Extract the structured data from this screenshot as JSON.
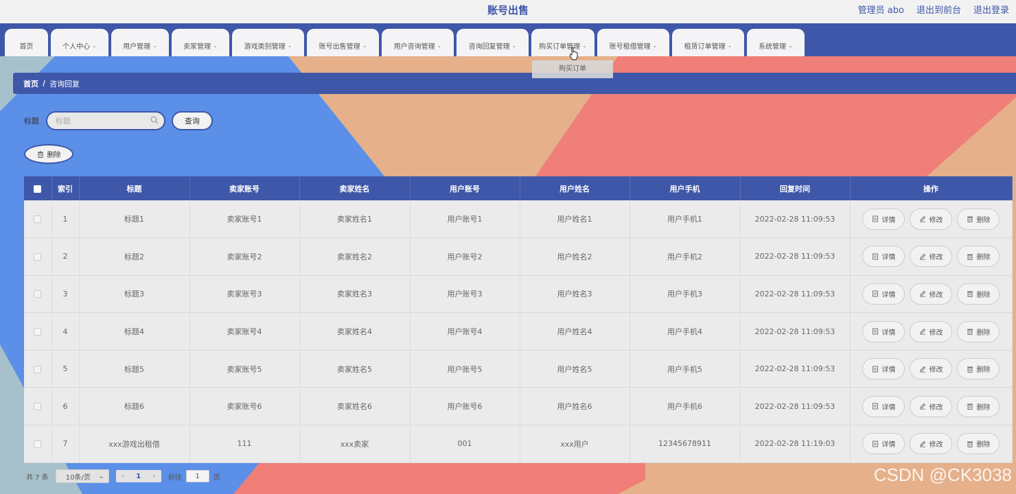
{
  "app": {
    "title": "账号出售"
  },
  "header": {
    "links": [
      "管理员 abo",
      "退出到前台",
      "退出登录"
    ]
  },
  "nav": {
    "tabs": [
      {
        "label": "首页",
        "has_dropdown": false
      },
      {
        "label": "个人中心",
        "has_dropdown": true
      },
      {
        "label": "用户管理",
        "has_dropdown": true
      },
      {
        "label": "卖家管理",
        "has_dropdown": true
      },
      {
        "label": "游戏类别管理",
        "has_dropdown": true
      },
      {
        "label": "账号出售管理",
        "has_dropdown": true
      },
      {
        "label": "用户咨询管理",
        "has_dropdown": true
      },
      {
        "label": "咨询回复管理",
        "has_dropdown": true
      },
      {
        "label": "购买订单管理",
        "has_dropdown": true
      },
      {
        "label": "账号租借管理",
        "has_dropdown": true
      },
      {
        "label": "租赁订单管理",
        "has_dropdown": true
      },
      {
        "label": "系统管理",
        "has_dropdown": true
      }
    ],
    "open_dropdown": {
      "item": "购买订单"
    }
  },
  "breadcrumb": {
    "home": "首页",
    "separator": "/",
    "current": "咨询回复"
  },
  "search": {
    "label": "标题",
    "placeholder": "标题",
    "value": "",
    "button": "查询"
  },
  "toolbar": {
    "delete_label": "删除"
  },
  "table": {
    "columns": [
      "索引",
      "标题",
      "卖家账号",
      "卖家姓名",
      "用户账号",
      "用户姓名",
      "用户手机",
      "回复时间",
      "操作"
    ],
    "rows": [
      {
        "index": "1",
        "title": "标题1",
        "seller_account": "卖家账号1",
        "seller_name": "卖家姓名1",
        "user_account": "用户账号1",
        "user_name": "用户姓名1",
        "user_phone": "用户手机1",
        "reply_time": "2022-02-28 11:09:53"
      },
      {
        "index": "2",
        "title": "标题2",
        "seller_account": "卖家账号2",
        "seller_name": "卖家姓名2",
        "user_account": "用户账号2",
        "user_name": "用户姓名2",
        "user_phone": "用户手机2",
        "reply_time": "2022-02-28 11:09:53"
      },
      {
        "index": "3",
        "title": "标题3",
        "seller_account": "卖家账号3",
        "seller_name": "卖家姓名3",
        "user_account": "用户账号3",
        "user_name": "用户姓名3",
        "user_phone": "用户手机3",
        "reply_time": "2022-02-28 11:09:53"
      },
      {
        "index": "4",
        "title": "标题4",
        "seller_account": "卖家账号4",
        "seller_name": "卖家姓名4",
        "user_account": "用户账号4",
        "user_name": "用户姓名4",
        "user_phone": "用户手机4",
        "reply_time": "2022-02-28 11:09:53"
      },
      {
        "index": "5",
        "title": "标题5",
        "seller_account": "卖家账号5",
        "seller_name": "卖家姓名5",
        "user_account": "用户账号5",
        "user_name": "用户姓名5",
        "user_phone": "用户手机5",
        "reply_time": "2022-02-28 11:09:53"
      },
      {
        "index": "6",
        "title": "标题6",
        "seller_account": "卖家账号6",
        "seller_name": "卖家姓名6",
        "user_account": "用户账号6",
        "user_name": "用户姓名6",
        "user_phone": "用户手机6",
        "reply_time": "2022-02-28 11:09:53"
      },
      {
        "index": "7",
        "title": "xxx游戏出租借",
        "seller_account": "111",
        "seller_name": "xxx卖家",
        "user_account": "001",
        "user_name": "xxx用户",
        "user_phone": "12345678911",
        "reply_time": "2022-02-28 11:19:03"
      }
    ],
    "row_actions": {
      "detail": "详情",
      "edit": "修改",
      "delete": "删除"
    }
  },
  "pagination": {
    "total_text": "共 7 条",
    "page_size": "10条/页",
    "current_page": "1",
    "goto_prefix": "前往",
    "goto_value": "1",
    "goto_suffix": "页"
  },
  "watermark": "CSDN @CK3038",
  "colors": {
    "primary": "#3e57a9",
    "bg_blue": "#5b8fe8",
    "bg_peach": "#e5b08a",
    "bg_coral": "#ef7f78",
    "bg_grey_blue": "#a6c1cb"
  },
  "icons": {
    "search": "magnifier-icon",
    "delete": "trash-icon",
    "detail": "document-icon",
    "edit": "pencil-icon",
    "chevron": "chevron-down-icon"
  }
}
